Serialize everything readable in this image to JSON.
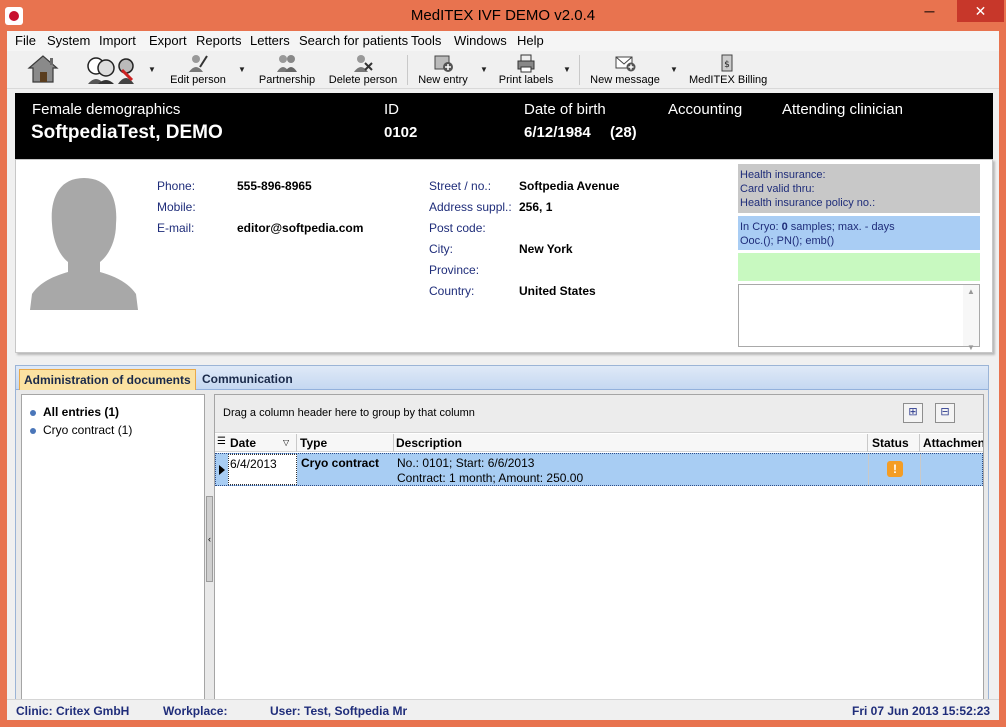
{
  "window": {
    "title": "MedITEX IVF DEMO v2.0.4",
    "min": "─",
    "max": "□",
    "close": "✕"
  },
  "menu": [
    "File",
    "System",
    "Import",
    "Export",
    "Reports",
    "Letters",
    "Search for patients",
    "Tools",
    "Windows",
    "Help"
  ],
  "toolbar": {
    "home_icon": "home-icon",
    "patients_icon": "patients-icon",
    "edit_person": "Edit person",
    "partnership": "Partnership",
    "delete_person": "Delete person",
    "new_entry": "New entry",
    "print_labels": "Print labels",
    "new_message": "New message",
    "billing": "MedITEX Billing",
    "dropdown": "▼"
  },
  "patient": {
    "demographics_label": "Female demographics",
    "name": "SoftpediaTest, DEMO",
    "id_label": "ID",
    "id": "0102",
    "dob_label": "Date of birth",
    "dob": "6/12/1984",
    "age": "(28)",
    "accounting_label": "Accounting",
    "clinician_label": "Attending clinician"
  },
  "contact": {
    "phone_label": "Phone:",
    "phone": "555-896-8965",
    "mobile_label": "Mobile:",
    "mobile": "",
    "email_label": "E-mail:",
    "email": "editor@softpedia.com",
    "street_label": "Street / no.:",
    "street": "Softpedia Avenue",
    "address_label": "Address suppl.:",
    "address": "256, 1",
    "postcode_label": "Post code:",
    "postcode": "",
    "city_label": "City:",
    "city": "New York",
    "province_label": "Province:",
    "province": "",
    "country_label": "Country:",
    "country": "United States"
  },
  "side": {
    "health_insurance": "Health insurance:",
    "card_valid": "Card valid thru:",
    "policy_no": "Health insurance policy no.:",
    "cryo_prefix": "In Cryo: ",
    "cryo_count": "0",
    "cryo_suffix": " samples; max. - days",
    "cryo_line2": "Ooc.(); PN(); emb()"
  },
  "tabs": {
    "docs": "Administration of documents",
    "communication": "Communication"
  },
  "tree": {
    "all_entries": "All entries (1)",
    "cryo_contract": "Cryo contract (1)"
  },
  "grid": {
    "group_hint": "Drag a column header here to group by that column",
    "expand": "⊞",
    "collapse": "⊟",
    "headers": {
      "date": "Date",
      "type": "Type",
      "description": "Description",
      "status": "Status",
      "attachments": "Attachments"
    },
    "rows": [
      {
        "date": "6/4/2013",
        "type": "Cryo contract",
        "desc1": "No.: 0101; Start: 6/6/2013",
        "desc2": "Contract: 1 month; Amount: 250.00",
        "status": "!"
      }
    ]
  },
  "status": {
    "clinic": "Clinic: Critex GmbH",
    "workplace": "Workplace:",
    "user": "User: Test, Softpedia Mr",
    "datetime": "Fri 07 Jun 2013 15:52:23"
  }
}
